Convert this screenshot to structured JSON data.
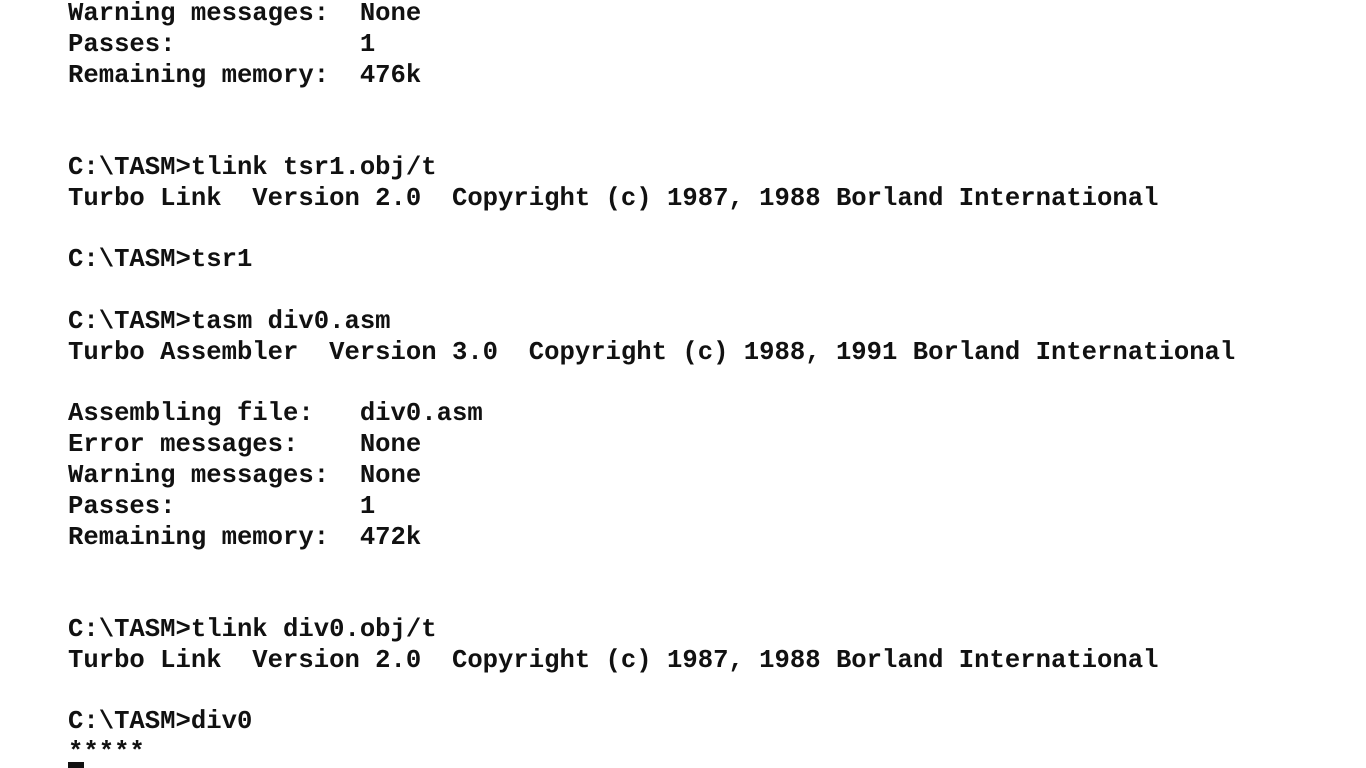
{
  "terminal": {
    "lines": [
      "Warning messages:  None",
      "Passes:            1",
      "Remaining memory:  476k",
      "",
      "",
      "C:\\TASM>tlink tsr1.obj/t",
      "Turbo Link  Version 2.0  Copyright (c) 1987, 1988 Borland International",
      "",
      "C:\\TASM>tsr1",
      "",
      "C:\\TASM>tasm div0.asm",
      "Turbo Assembler  Version 3.0  Copyright (c) 1988, 1991 Borland International",
      "",
      "Assembling file:   div0.asm",
      "Error messages:    None",
      "Warning messages:  None",
      "Passes:            1",
      "Remaining memory:  472k",
      "",
      "",
      "C:\\TASM>tlink div0.obj/t",
      "Turbo Link  Version 2.0  Copyright (c) 1987, 1988 Borland International",
      "",
      "C:\\TASM>div0",
      "*****"
    ]
  }
}
